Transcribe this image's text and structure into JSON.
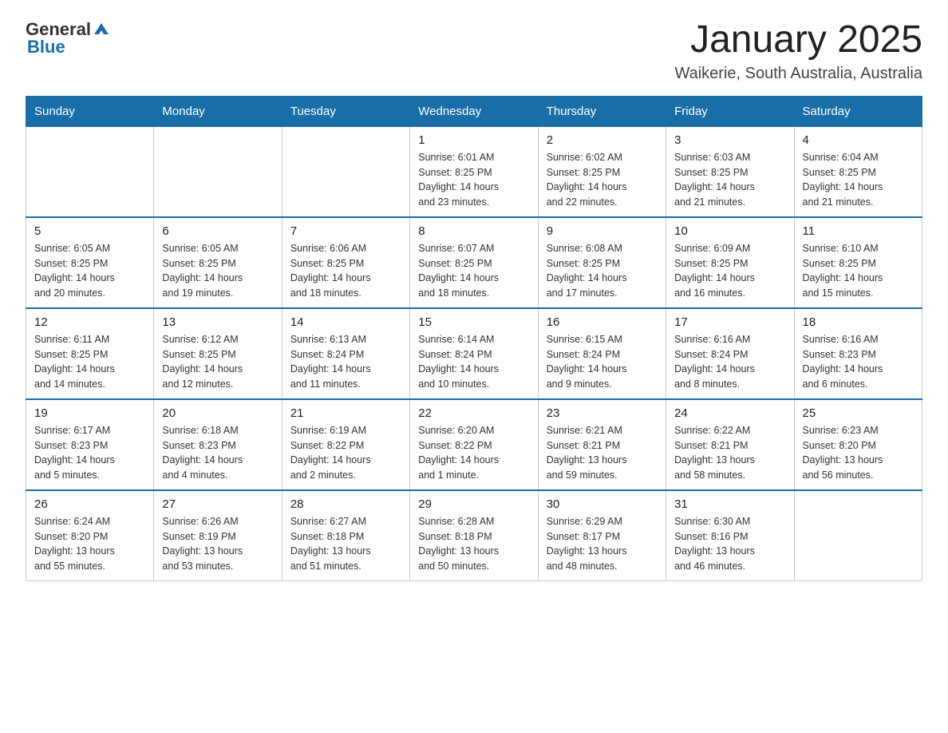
{
  "header": {
    "logo_general": "General",
    "logo_blue": "Blue",
    "title": "January 2025",
    "subtitle": "Waikerie, South Australia, Australia"
  },
  "days_of_week": [
    "Sunday",
    "Monday",
    "Tuesday",
    "Wednesday",
    "Thursday",
    "Friday",
    "Saturday"
  ],
  "weeks": [
    {
      "days": [
        {
          "number": "",
          "info": ""
        },
        {
          "number": "",
          "info": ""
        },
        {
          "number": "",
          "info": ""
        },
        {
          "number": "1",
          "info": "Sunrise: 6:01 AM\nSunset: 8:25 PM\nDaylight: 14 hours\nand 23 minutes."
        },
        {
          "number": "2",
          "info": "Sunrise: 6:02 AM\nSunset: 8:25 PM\nDaylight: 14 hours\nand 22 minutes."
        },
        {
          "number": "3",
          "info": "Sunrise: 6:03 AM\nSunset: 8:25 PM\nDaylight: 14 hours\nand 21 minutes."
        },
        {
          "number": "4",
          "info": "Sunrise: 6:04 AM\nSunset: 8:25 PM\nDaylight: 14 hours\nand 21 minutes."
        }
      ]
    },
    {
      "days": [
        {
          "number": "5",
          "info": "Sunrise: 6:05 AM\nSunset: 8:25 PM\nDaylight: 14 hours\nand 20 minutes."
        },
        {
          "number": "6",
          "info": "Sunrise: 6:05 AM\nSunset: 8:25 PM\nDaylight: 14 hours\nand 19 minutes."
        },
        {
          "number": "7",
          "info": "Sunrise: 6:06 AM\nSunset: 8:25 PM\nDaylight: 14 hours\nand 18 minutes."
        },
        {
          "number": "8",
          "info": "Sunrise: 6:07 AM\nSunset: 8:25 PM\nDaylight: 14 hours\nand 18 minutes."
        },
        {
          "number": "9",
          "info": "Sunrise: 6:08 AM\nSunset: 8:25 PM\nDaylight: 14 hours\nand 17 minutes."
        },
        {
          "number": "10",
          "info": "Sunrise: 6:09 AM\nSunset: 8:25 PM\nDaylight: 14 hours\nand 16 minutes."
        },
        {
          "number": "11",
          "info": "Sunrise: 6:10 AM\nSunset: 8:25 PM\nDaylight: 14 hours\nand 15 minutes."
        }
      ]
    },
    {
      "days": [
        {
          "number": "12",
          "info": "Sunrise: 6:11 AM\nSunset: 8:25 PM\nDaylight: 14 hours\nand 14 minutes."
        },
        {
          "number": "13",
          "info": "Sunrise: 6:12 AM\nSunset: 8:25 PM\nDaylight: 14 hours\nand 12 minutes."
        },
        {
          "number": "14",
          "info": "Sunrise: 6:13 AM\nSunset: 8:24 PM\nDaylight: 14 hours\nand 11 minutes."
        },
        {
          "number": "15",
          "info": "Sunrise: 6:14 AM\nSunset: 8:24 PM\nDaylight: 14 hours\nand 10 minutes."
        },
        {
          "number": "16",
          "info": "Sunrise: 6:15 AM\nSunset: 8:24 PM\nDaylight: 14 hours\nand 9 minutes."
        },
        {
          "number": "17",
          "info": "Sunrise: 6:16 AM\nSunset: 8:24 PM\nDaylight: 14 hours\nand 8 minutes."
        },
        {
          "number": "18",
          "info": "Sunrise: 6:16 AM\nSunset: 8:23 PM\nDaylight: 14 hours\nand 6 minutes."
        }
      ]
    },
    {
      "days": [
        {
          "number": "19",
          "info": "Sunrise: 6:17 AM\nSunset: 8:23 PM\nDaylight: 14 hours\nand 5 minutes."
        },
        {
          "number": "20",
          "info": "Sunrise: 6:18 AM\nSunset: 8:23 PM\nDaylight: 14 hours\nand 4 minutes."
        },
        {
          "number": "21",
          "info": "Sunrise: 6:19 AM\nSunset: 8:22 PM\nDaylight: 14 hours\nand 2 minutes."
        },
        {
          "number": "22",
          "info": "Sunrise: 6:20 AM\nSunset: 8:22 PM\nDaylight: 14 hours\nand 1 minute."
        },
        {
          "number": "23",
          "info": "Sunrise: 6:21 AM\nSunset: 8:21 PM\nDaylight: 13 hours\nand 59 minutes."
        },
        {
          "number": "24",
          "info": "Sunrise: 6:22 AM\nSunset: 8:21 PM\nDaylight: 13 hours\nand 58 minutes."
        },
        {
          "number": "25",
          "info": "Sunrise: 6:23 AM\nSunset: 8:20 PM\nDaylight: 13 hours\nand 56 minutes."
        }
      ]
    },
    {
      "days": [
        {
          "number": "26",
          "info": "Sunrise: 6:24 AM\nSunset: 8:20 PM\nDaylight: 13 hours\nand 55 minutes."
        },
        {
          "number": "27",
          "info": "Sunrise: 6:26 AM\nSunset: 8:19 PM\nDaylight: 13 hours\nand 53 minutes."
        },
        {
          "number": "28",
          "info": "Sunrise: 6:27 AM\nSunset: 8:18 PM\nDaylight: 13 hours\nand 51 minutes."
        },
        {
          "number": "29",
          "info": "Sunrise: 6:28 AM\nSunset: 8:18 PM\nDaylight: 13 hours\nand 50 minutes."
        },
        {
          "number": "30",
          "info": "Sunrise: 6:29 AM\nSunset: 8:17 PM\nDaylight: 13 hours\nand 48 minutes."
        },
        {
          "number": "31",
          "info": "Sunrise: 6:30 AM\nSunset: 8:16 PM\nDaylight: 13 hours\nand 46 minutes."
        },
        {
          "number": "",
          "info": ""
        }
      ]
    }
  ]
}
